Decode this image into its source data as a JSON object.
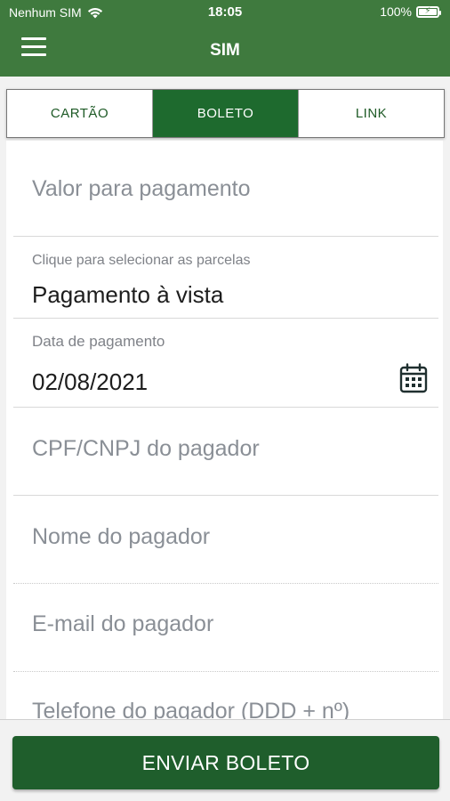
{
  "status": {
    "carrier": "Nenhum SIM",
    "time": "18:05",
    "battery": "100%"
  },
  "header": {
    "title": "SIM"
  },
  "tabs": [
    {
      "label": "CARTÃO",
      "active": false
    },
    {
      "label": "BOLETO",
      "active": true
    },
    {
      "label": "LINK",
      "active": false
    }
  ],
  "form": {
    "amount_placeholder": "Valor para pagamento",
    "installments_label": "Clique para selecionar as parcelas",
    "installments_value": "Pagamento à vista",
    "date_label": "Data de pagamento",
    "date_value": "02/08/2021",
    "document_placeholder": "CPF/CNPJ do pagador",
    "name_placeholder": "Nome do pagador",
    "email_placeholder": "E-mail do pagador",
    "phone_placeholder": "Telefone do pagador (DDD + nº)"
  },
  "actions": {
    "send_label": "ENVIAR BOLETO"
  },
  "colors": {
    "header": "#3f7a3e",
    "primary": "#1e6a2e",
    "button": "#1f5e2c"
  },
  "icons": [
    "menu-icon",
    "wifi-icon",
    "battery-icon",
    "calendar-icon"
  ]
}
